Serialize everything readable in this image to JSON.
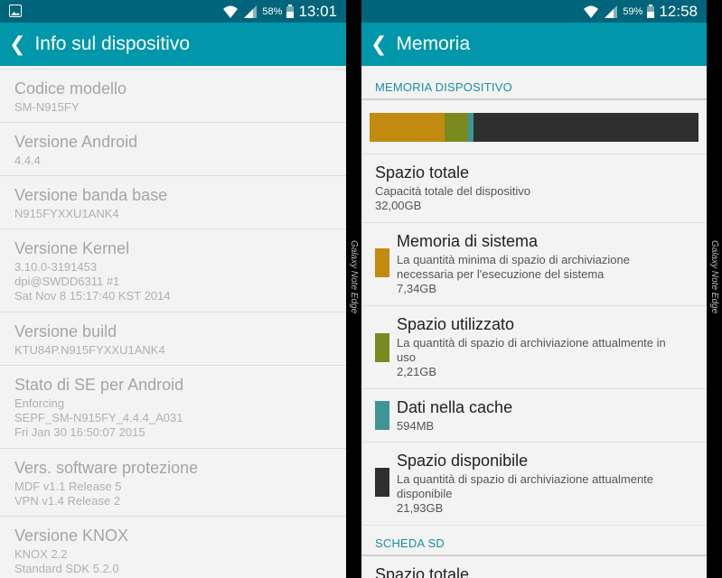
{
  "left": {
    "status": {
      "battery_pct": "58%",
      "time": "13:01"
    },
    "title": "Info sul dispositivo",
    "items": [
      {
        "title": "Codice modello",
        "lines": [
          "SM-N915FY"
        ]
      },
      {
        "title": "Versione Android",
        "lines": [
          "4.4.4"
        ]
      },
      {
        "title": "Versione banda base",
        "lines": [
          "N915FYXXU1ANK4"
        ]
      },
      {
        "title": "Versione Kernel",
        "lines": [
          "3.10.0-3191453",
          "dpi@SWDD6311 #1",
          "Sat Nov 8 15:17:40 KST 2014"
        ]
      },
      {
        "title": "Versione build",
        "lines": [
          "KTU84P.N915FYXXU1ANK4"
        ]
      },
      {
        "title": "Stato di SE per Android",
        "lines": [
          "Enforcing",
          "SEPF_SM-N915FY_4.4.4_A031",
          "Fri Jan 30 16:50:07 2015"
        ]
      },
      {
        "title": "Vers. software protezione",
        "lines": [
          "MDF v1.1 Release 5",
          "VPN v1.4 Release 2"
        ]
      },
      {
        "title": "Versione KNOX",
        "lines": [
          "KNOX 2.2",
          "Standard SDK 5.2.0"
        ]
      }
    ]
  },
  "right": {
    "status": {
      "battery_pct": "59%",
      "time": "12:58"
    },
    "title": "Memoria",
    "section_device": "MEMORIA DISPOSITIVO",
    "bar": {
      "total_gb": 32.0,
      "segments": [
        {
          "name": "sistema",
          "gb": 7.34,
          "color": "#c28a0f"
        },
        {
          "name": "utilizzato",
          "gb": 2.21,
          "color": "#7a8a20"
        },
        {
          "name": "cache",
          "gb": 0.594,
          "color": "#3f9595"
        }
      ],
      "free_color": "#2f2f2f"
    },
    "total": {
      "title": "Spazio totale",
      "desc": "Capacità totale del dispositivo",
      "value": "32,00GB"
    },
    "items": [
      {
        "title": "Memoria di sistema",
        "desc": [
          "La quantità minima di spazio di archiviazione",
          "necessaria per l'esecuzione del sistema"
        ],
        "value": "7,34GB",
        "color": "#c28a0f"
      },
      {
        "title": "Spazio utilizzato",
        "desc": [
          "La quantità di spazio di archiviazione attualmente in",
          "uso"
        ],
        "value": "2,21GB",
        "color": "#7a8a20"
      },
      {
        "title": "Dati nella cache",
        "desc": [],
        "value": "594MB",
        "color": "#3f9595"
      },
      {
        "title": "Spazio disponibile",
        "desc": [
          "La quantità di spazio di archiviazione attualmente",
          "disponibile"
        ],
        "value": "21,93GB",
        "color": "#2f2f2f"
      }
    ],
    "section_sd": "SCHEDA SD",
    "sd_total_title": "Spazio totale"
  },
  "watermark": "Galaxy Note Edge"
}
